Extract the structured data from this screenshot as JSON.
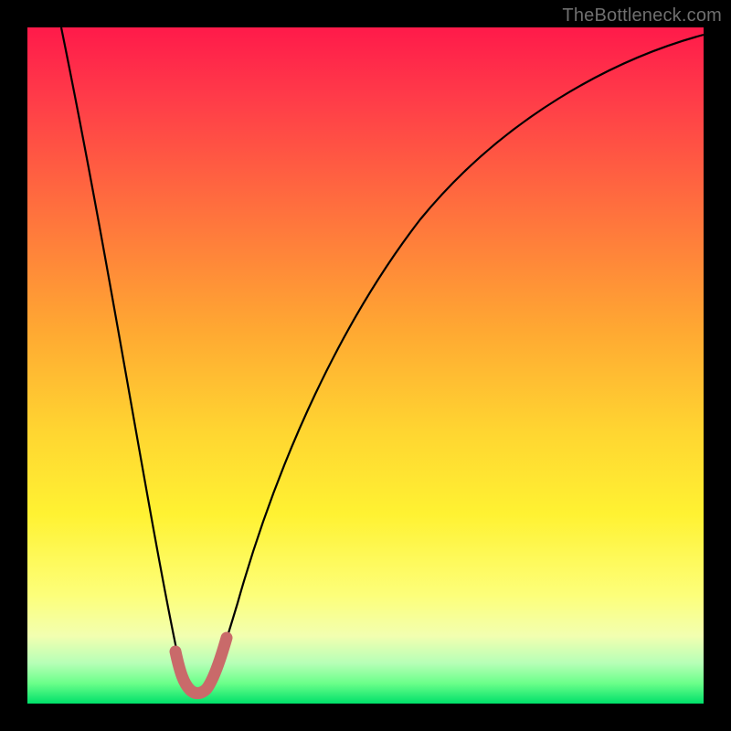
{
  "watermark": {
    "text": "TheBottleneck.com"
  },
  "colors": {
    "curve": "#000000",
    "optimal_highlight": "#c96a6a",
    "background_black": "#000000"
  },
  "chart_data": {
    "type": "line",
    "title": "",
    "xlabel": "",
    "ylabel": "",
    "xlim": [
      0,
      100
    ],
    "ylim": [
      0,
      100
    ],
    "x": [
      0,
      5,
      10,
      15,
      20,
      23,
      25,
      27,
      30,
      35,
      40,
      45,
      50,
      55,
      60,
      65,
      70,
      75,
      80,
      85,
      90,
      95,
      100
    ],
    "y": [
      100,
      80,
      60,
      40,
      20,
      6,
      2,
      6,
      18,
      34,
      46,
      55,
      62,
      68,
      73,
      77,
      80,
      83,
      85,
      87,
      89,
      90.5,
      92
    ],
    "optimal_region": {
      "x_start": 22,
      "x_end": 29,
      "y_max": 7
    },
    "notes": "Y is bottleneck percentage where 0 is ideal (bottom/green) and 100 is worst (top/red). Minimum occurs near x≈25."
  }
}
